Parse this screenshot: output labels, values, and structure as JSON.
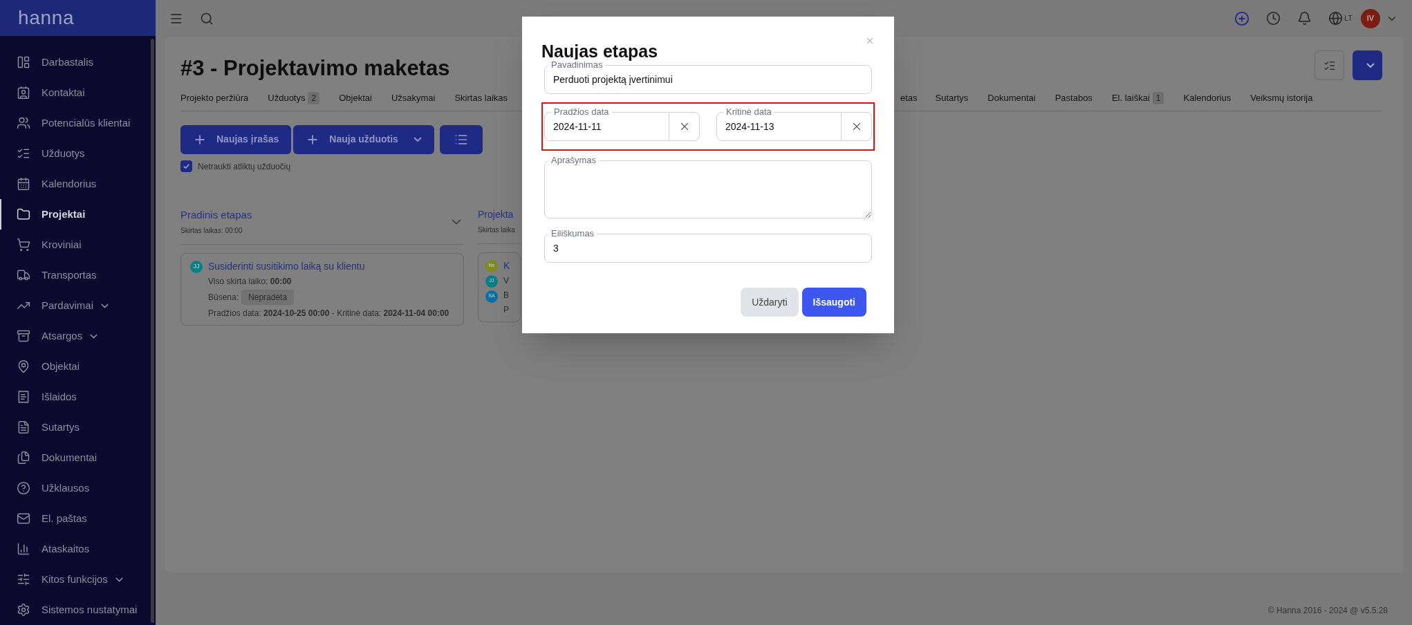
{
  "brand": "hanna",
  "sidebar": {
    "items": [
      {
        "label": "Darbastalis",
        "selected": false,
        "has_submenu": false
      },
      {
        "label": "Kontaktai",
        "selected": false,
        "has_submenu": false
      },
      {
        "label": "Potencialūs klientai",
        "selected": false,
        "has_submenu": false
      },
      {
        "label": "Užduotys",
        "selected": false,
        "has_submenu": false
      },
      {
        "label": "Kalendorius",
        "selected": false,
        "has_submenu": false
      },
      {
        "label": "Projektai",
        "selected": true,
        "has_submenu": false
      },
      {
        "label": "Kroviniai",
        "selected": false,
        "has_submenu": false
      },
      {
        "label": "Transportas",
        "selected": false,
        "has_submenu": false
      },
      {
        "label": "Pardavimai",
        "selected": false,
        "has_submenu": true
      },
      {
        "label": "Atsargos",
        "selected": false,
        "has_submenu": true
      },
      {
        "label": "Objektai",
        "selected": false,
        "has_submenu": false
      },
      {
        "label": "Išlaidos",
        "selected": false,
        "has_submenu": false
      },
      {
        "label": "Sutartys",
        "selected": false,
        "has_submenu": false
      },
      {
        "label": "Dokumentai",
        "selected": false,
        "has_submenu": false
      },
      {
        "label": "Užklausos",
        "selected": false,
        "has_submenu": false
      },
      {
        "label": "El. paštas",
        "selected": false,
        "has_submenu": false
      },
      {
        "label": "Ataskaitos",
        "selected": false,
        "has_submenu": false
      },
      {
        "label": "Kitos funkcijos",
        "selected": false,
        "has_submenu": true
      },
      {
        "label": "Sistemos nustatymai",
        "selected": false,
        "has_submenu": false
      }
    ]
  },
  "topbar": {
    "language": "LT",
    "avatar": "IV"
  },
  "page": {
    "title": "#3 - Projektavimo maketas",
    "tabs": [
      {
        "label": "Projekto peržiūra",
        "kind": "full"
      },
      {
        "label": "Užduotys",
        "count": "2",
        "kind": "full"
      },
      {
        "label": "Objektai",
        "kind": "full"
      },
      {
        "label": "Užsakymai",
        "kind": "full"
      },
      {
        "label": "Skirtas laikas",
        "kind": "full"
      },
      {
        "label": "etas",
        "kind": "cut"
      },
      {
        "label": "Sutartys",
        "kind": "full"
      },
      {
        "label": "Dokumentai",
        "kind": "full"
      },
      {
        "label": "Pastabos",
        "kind": "full"
      },
      {
        "label": "El. laiškai",
        "count": "1",
        "kind": "full"
      },
      {
        "label": "Kalendorius",
        "kind": "full"
      },
      {
        "label": "Veiksmų istorija",
        "kind": "full"
      }
    ],
    "actions": [
      "Naujas įrašas",
      "Nauja užduotis"
    ],
    "hide_done": {
      "label": "Netraukti atliktų užduočių",
      "checked": true
    },
    "stages": [
      {
        "title": "Pradinis etapas",
        "subtitle": "Skirtas laikas: 00:00",
        "kind": "full",
        "tasks": [
          {
            "avatars": [
              {
                "initials": "JJ",
                "color": "#0b7f86"
              }
            ],
            "lines": [
              {
                "kind": "title",
                "text": "Susiderinti susitikimo laiką su klientu"
              },
              {
                "kind": "text",
                "text": "Viso skirta laiko: **00:00**"
              },
              {
                "kind": "status",
                "text": "Būsena:",
                "badge": "Nepradėta"
              },
              {
                "kind": "text",
                "text": "Pradžios data: **2024-10-25 00:00** - Kritinė data: **2024-11-04 00:00**"
              }
            ]
          }
        ]
      },
      {
        "title": "Projekta",
        "subtitle": "Skirtas laika",
        "kind": "cut",
        "tasks": [
          {
            "avatars": [
              {
                "initials": "Ns",
                "color": "#7f8a1c"
              },
              {
                "initials": "JJ",
                "color": "#0b7f86"
              },
              {
                "initials": "SA",
                "color": "#0a6fa8"
              }
            ],
            "lines": [
              {
                "kind": "title",
                "text": "K"
              },
              {
                "kind": "text",
                "text": "V"
              },
              {
                "kind": "text",
                "text": "B"
              },
              {
                "kind": "text",
                "text": "P"
              }
            ]
          }
        ]
      }
    ]
  },
  "modal": {
    "title": "Naujas etapas",
    "name": {
      "label": "Pavadinimas",
      "value": "Perduoti projektą įvertinimui"
    },
    "dates_highlighted": true,
    "dates": [
      {
        "label": "Pradžios data",
        "value": "2024-11-11"
      },
      {
        "label": "Kritinė data",
        "value": "2024-11-13"
      }
    ],
    "description": {
      "label": "Aprašymas"
    },
    "order": {
      "label": "Eiliškumas",
      "value": "3"
    },
    "buttons": [
      {
        "label": "Uždaryti",
        "kind": "secondary"
      },
      {
        "label": "Išsaugoti",
        "kind": "primary"
      }
    ]
  },
  "footer": "© Hanna 2016 - 2024 @ v5.5.28"
}
